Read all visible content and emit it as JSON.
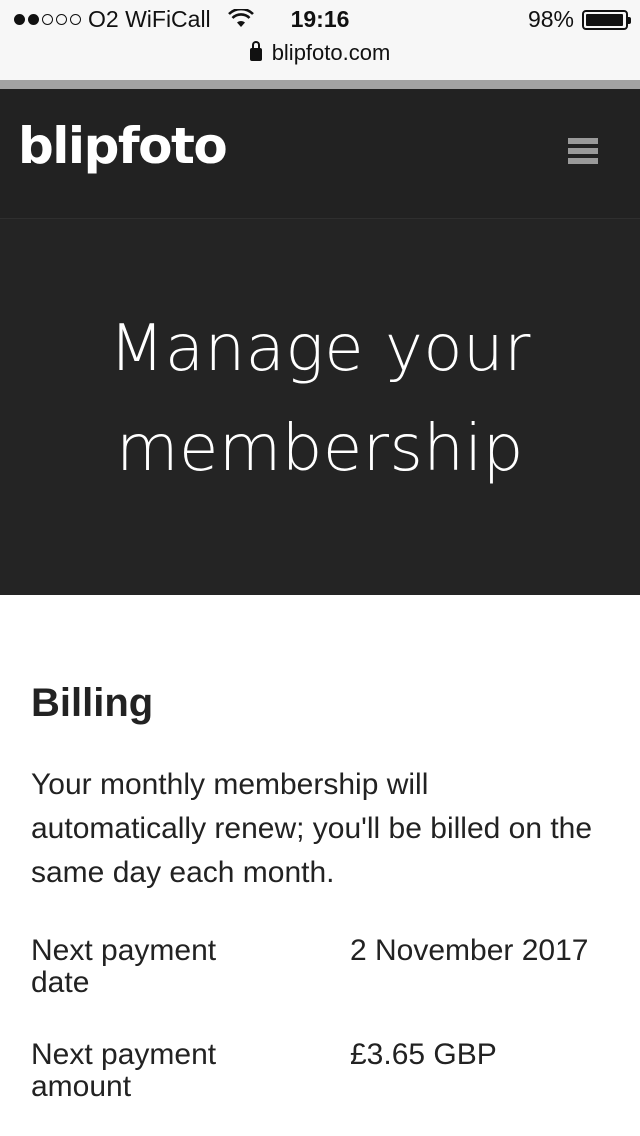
{
  "status_bar": {
    "carrier": "O2 WiFiCall",
    "time": "19:16",
    "battery": "98%",
    "battery_level": 0.98,
    "signal_bars_filled": 2,
    "signal_bars_total": 5
  },
  "browser": {
    "url": "blipfoto.com"
  },
  "header": {
    "logo": "blipfoto",
    "menu_icon": "hamburger-menu-icon"
  },
  "hero": {
    "title_line1": "Manage your",
    "title_line2": "membership"
  },
  "billing": {
    "title": "Billing",
    "description": "Your monthly membership will automatically renew; you'll be billed on the same day each month.",
    "rows": [
      {
        "label": "Next payment date",
        "value": "2 November 2017"
      },
      {
        "label": "Next payment amount",
        "value": "£3.65 GBP"
      }
    ]
  },
  "colors": {
    "header_bg": "#222222",
    "hero_bg": "#242424",
    "text": "#222222"
  }
}
